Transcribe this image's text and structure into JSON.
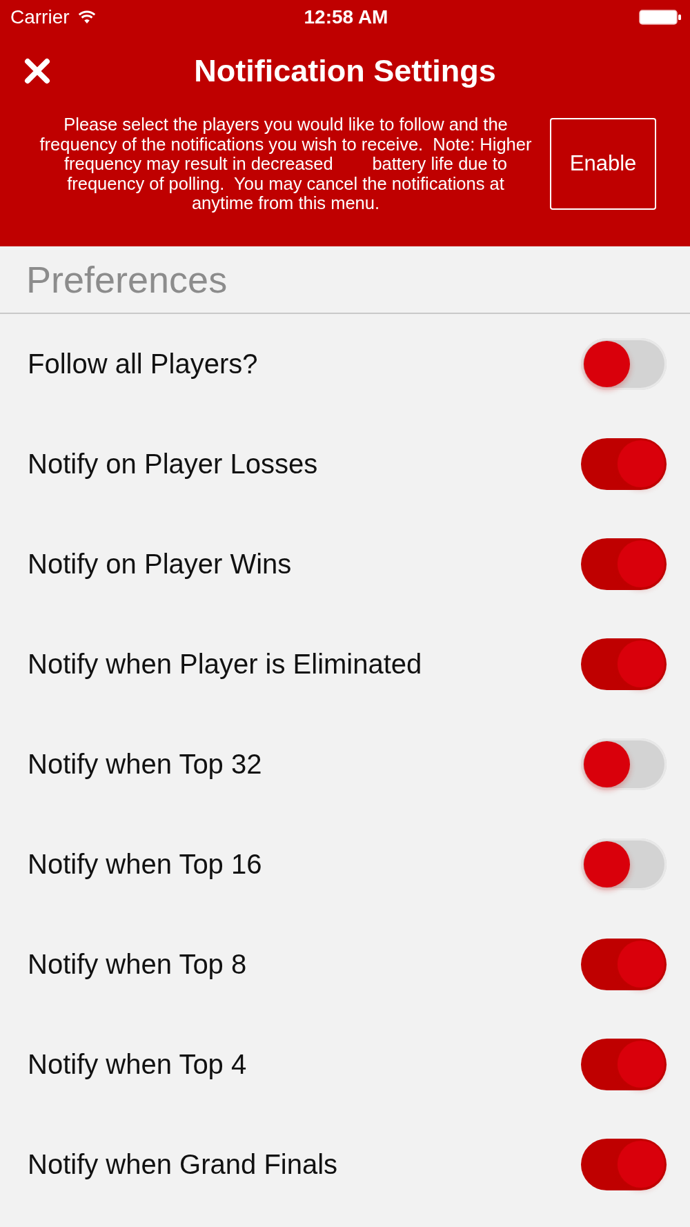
{
  "status_bar": {
    "carrier": "Carrier",
    "time": "12:58 AM"
  },
  "header": {
    "title": "Notification Settings",
    "description": "Please select the players you would like to follow and the frequency of the notifications you wish to receive.  Note: Higher frequency may result in decreased        battery life due to frequency of polling.  You may cancel the notifications at anytime from this menu.",
    "button": "Enable"
  },
  "section": {
    "title": "Preferences"
  },
  "rows": [
    {
      "label": "Follow all Players?",
      "on": false
    },
    {
      "label": "Notify on Player Losses",
      "on": true
    },
    {
      "label": "Notify on Player Wins",
      "on": true
    },
    {
      "label": "Notify when Player is Eliminated",
      "on": true
    },
    {
      "label": "Notify when Top 32",
      "on": false
    },
    {
      "label": "Notify when Top 16",
      "on": false
    },
    {
      "label": "Notify when Top 8",
      "on": true
    },
    {
      "label": "Notify when Top 4",
      "on": true
    },
    {
      "label": "Notify when Grand Finals",
      "on": true
    }
  ]
}
